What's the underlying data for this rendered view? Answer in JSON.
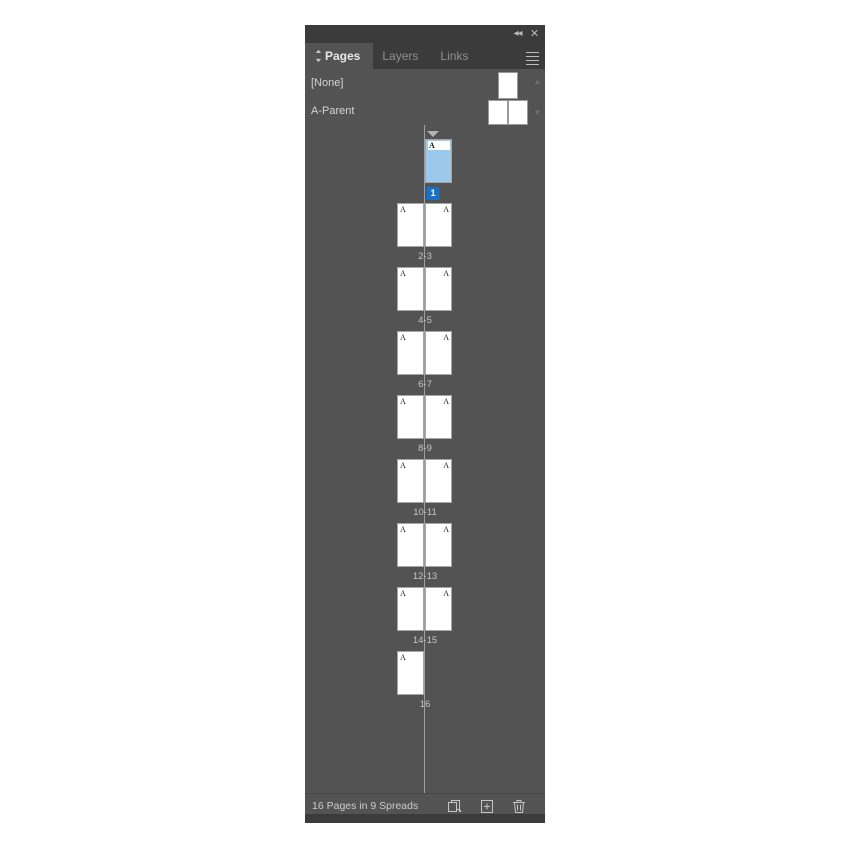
{
  "panel": {
    "titlebar": {
      "collapse_label": "◂◂",
      "close_label": "✕"
    },
    "tabs": [
      {
        "label": "Pages",
        "active": true
      },
      {
        "label": "Layers",
        "active": false
      },
      {
        "label": "Links",
        "active": false
      }
    ],
    "menu_icon": "hamburger-menu-icon"
  },
  "parent_pages": [
    {
      "name": "[None]",
      "thumbs": 1
    },
    {
      "name": "A-Parent",
      "thumbs": 2
    }
  ],
  "document_pages": {
    "spreads": [
      {
        "label": "1",
        "pages": [
          "A"
        ],
        "side": "right",
        "selected": true
      },
      {
        "label": "2-3",
        "pages": [
          "A",
          "A"
        ],
        "side": "both",
        "selected": false
      },
      {
        "label": "4-5",
        "pages": [
          "A",
          "A"
        ],
        "side": "both",
        "selected": false
      },
      {
        "label": "6-7",
        "pages": [
          "A",
          "A"
        ],
        "side": "both",
        "selected": false
      },
      {
        "label": "8-9",
        "pages": [
          "A",
          "A"
        ],
        "side": "both",
        "selected": false
      },
      {
        "label": "10-11",
        "pages": [
          "A",
          "A"
        ],
        "side": "both",
        "selected": false
      },
      {
        "label": "12-13",
        "pages": [
          "A",
          "A"
        ],
        "side": "both",
        "selected": false
      },
      {
        "label": "14-15",
        "pages": [
          "A",
          "A"
        ],
        "side": "both",
        "selected": false
      },
      {
        "label": "16",
        "pages": [
          "A"
        ],
        "side": "left",
        "selected": false
      }
    ]
  },
  "statusbar": {
    "summary": "16 Pages in 9 Spreads",
    "icons": [
      "edit-page-size-icon",
      "new-page-icon",
      "delete-page-icon"
    ]
  },
  "colors": {
    "panel_bg": "#535353",
    "chrome_bg": "#3b3b3b",
    "selection_blue": "#9cc8ec",
    "badge_blue": "#1473c8",
    "page_white": "#ffffff"
  }
}
